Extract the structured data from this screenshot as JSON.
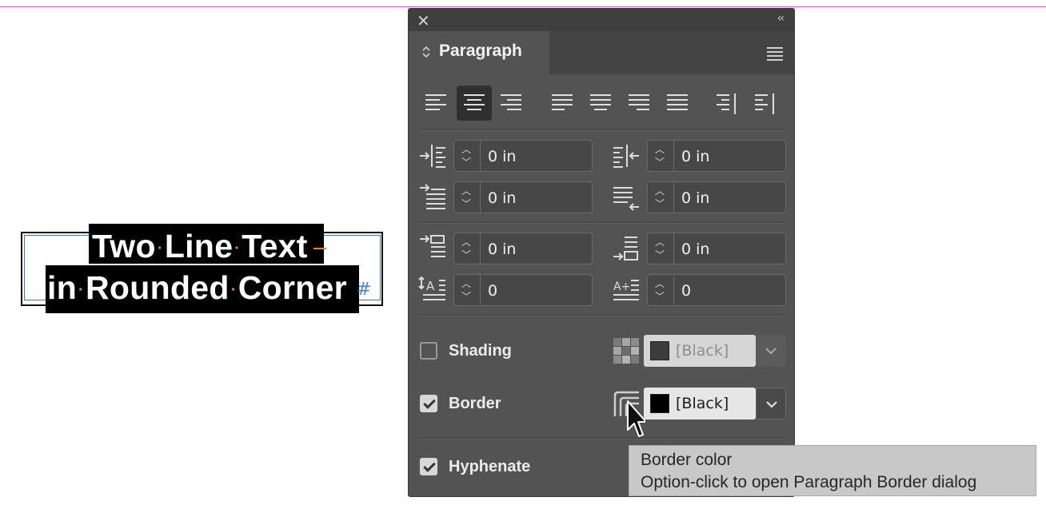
{
  "canvas": {
    "line1_words": [
      "Two",
      "Line",
      "Text"
    ],
    "line2_words": [
      "in",
      "Rounded",
      "Corner"
    ],
    "end_marker": "#"
  },
  "panel": {
    "close_glyph": "✕",
    "collapse_glyph": "‹‹",
    "tab_label": "Paragraph",
    "tab_arrows": "⌃⌄",
    "alignment_buttons": [
      "align-left",
      "align-center",
      "align-right",
      "justify-left",
      "justify-center",
      "justify-right",
      "justify-all",
      "align-toward-spine",
      "align-away-from-spine"
    ],
    "active_alignment": "align-center",
    "fields": {
      "left_indent": "0 in",
      "right_indent": "0 in",
      "first_line_indent": "0 in",
      "last_line_right_indent": "0 in",
      "space_before": "0 in",
      "space_after": "0 in",
      "drop_cap_lines": "0",
      "drop_cap_characters": "0"
    },
    "shading": {
      "label": "Shading",
      "checked": false,
      "color": "[Black]",
      "swatch_hex": "#3c3c3c"
    },
    "border": {
      "label": "Border",
      "checked": true,
      "color": "[Black]",
      "swatch_hex": "#000000"
    },
    "hyphenate": {
      "label": "Hyphenate",
      "checked": true
    }
  },
  "tooltip": {
    "line1": "Border color",
    "line2": "Option-click to open Paragraph Border dialog"
  },
  "colors": {
    "panel_bg": "#535353",
    "guide": "#e05ae0",
    "frame_selection": "#3d6fd8"
  }
}
